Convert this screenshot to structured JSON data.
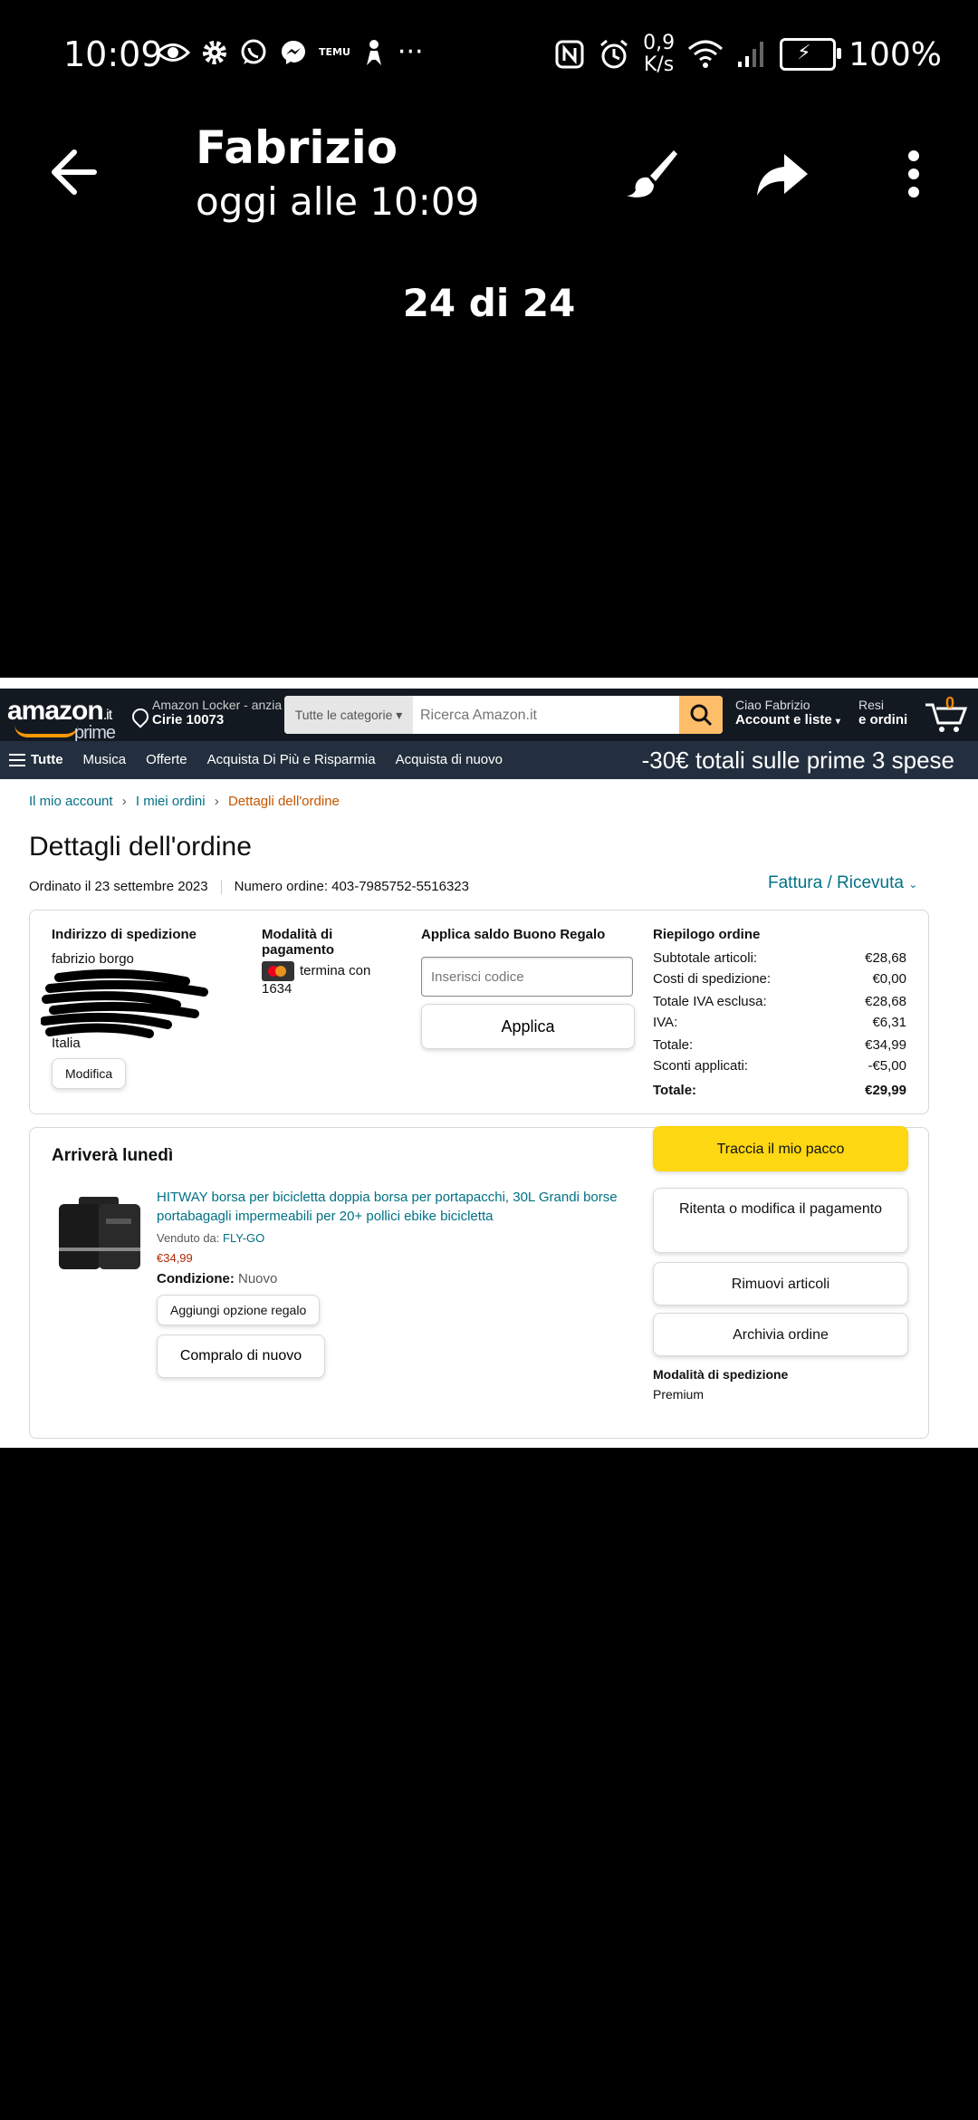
{
  "status_bar": {
    "time": "10:09",
    "left_icons": [
      "eye-icon",
      "gear-icon",
      "whatsapp-icon",
      "messenger-icon",
      "temu-icon",
      "figure-icon",
      "more-icon"
    ],
    "temu_text": "TEMU",
    "more": "···",
    "net_speed_value": "0,9",
    "net_speed_unit": "K/s",
    "battery": "100%"
  },
  "viewer": {
    "sender": "Fabrizio",
    "timestamp": "oggi alle 10:09",
    "counter": "24 di 24"
  },
  "amazon": {
    "logo": "amazon",
    "logo_tld": ".it",
    "logo_sub": "prime",
    "location_line1": "Amazon Locker - anzia",
    "location_line2": "Cirie 10073",
    "search_category": "Tutte le categorie",
    "search_placeholder": "Ricerca Amazon.it",
    "account_line1": "Ciao Fabrizio",
    "account_line2": "Account e liste",
    "orders_line1": "Resi",
    "orders_line2": "e ordini",
    "cart_count": "0",
    "nav": [
      "Tutte",
      "Musica",
      "Offerte",
      "Acquista Di Più e Risparmia",
      "Acquista di nuovo"
    ],
    "promo": "-30€ totali sulle prime 3 spese",
    "breadcrumb": [
      "Il mio account",
      "I miei ordini",
      "Dettagli dell'ordine"
    ],
    "page_title": "Dettagli dell'ordine",
    "ordered_on": "Ordinato il 23 settembre 2023",
    "order_number": "Numero ordine: 403-7985752-5516323",
    "invoice": "Fattura / Ricevuta",
    "shipping": {
      "heading": "Indirizzo di spedizione",
      "name": "fabrizio borgo",
      "country": "Italia",
      "edit_label": "Modifica"
    },
    "payment": {
      "heading": "Modalità di pagamento",
      "card_text": "termina con 1634"
    },
    "gift": {
      "heading": "Applica saldo Buono Regalo",
      "placeholder": "Inserisci codice",
      "apply_label": "Applica"
    },
    "summary": {
      "heading": "Riepilogo ordine",
      "rows": [
        {
          "label": "Subtotale articoli:",
          "value": "€28,68"
        },
        {
          "label": "Costi di spedizione:",
          "value": "€0,00"
        },
        {
          "label": "Totale IVA esclusa:",
          "value": "€28,68"
        },
        {
          "label": "IVA:",
          "value": "€6,31"
        },
        {
          "label": "Totale:",
          "value": "€34,99"
        },
        {
          "label": "Sconti applicati:",
          "value": "-€5,00"
        }
      ],
      "total_label": "Totale:",
      "total_value": "€29,99"
    },
    "shipment": {
      "arrival": "Arriverà lunedì",
      "product_title": "HITWAY borsa per bicicletta doppia borsa per portapacchi, 30L Grandi borse portabagagli impermeabili per 20+ pollici ebike bicicletta",
      "sold_by_label": "Venduto da:",
      "seller": "FLY-GO",
      "price": "€34,99",
      "condition_label": "Condizione:",
      "condition_value": "Nuovo",
      "gift_option": "Aggiungi opzione regalo",
      "buy_again": "Compralo di nuovo",
      "actions": [
        "Traccia il mio pacco",
        "Ritenta o modifica il pagamento",
        "Rimuovi articoli",
        "Archivia ordine"
      ],
      "ship_mode_label": "Modalità di spedizione",
      "ship_mode_value": "Premium"
    }
  }
}
